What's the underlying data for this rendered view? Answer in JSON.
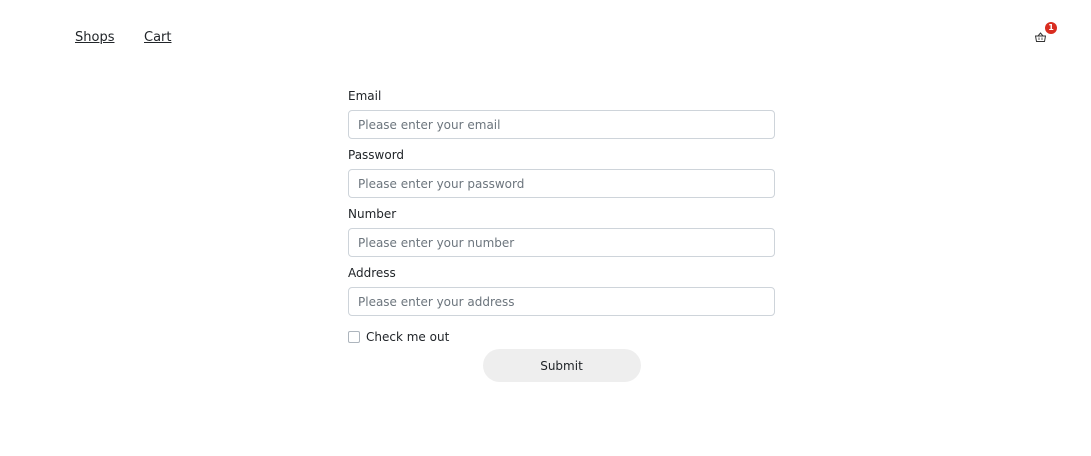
{
  "nav": {
    "shops_label": "Shops",
    "cart_label": "Cart",
    "cart_badge_count": "1",
    "cart_icon": "basket-icon",
    "badge_color": "#d92d20"
  },
  "form": {
    "email": {
      "label": "Email",
      "placeholder": "Please enter your email",
      "value": ""
    },
    "password": {
      "label": "Password",
      "placeholder": "Please enter your password",
      "value": ""
    },
    "number": {
      "label": "Number",
      "placeholder": "Please enter your number",
      "value": ""
    },
    "address": {
      "label": "Address",
      "placeholder": "Please enter your address",
      "value": ""
    },
    "checkbox_label": "Check me out",
    "checkbox_checked": false,
    "submit_label": "Submit"
  }
}
